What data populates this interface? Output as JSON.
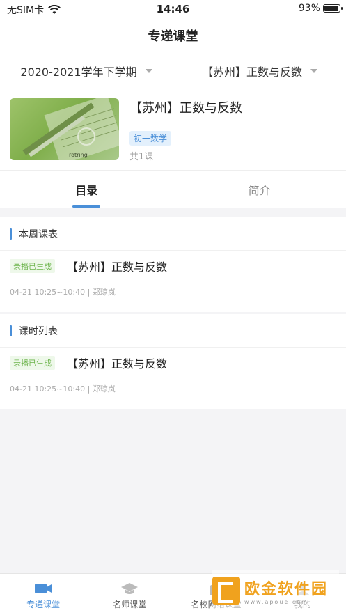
{
  "status_bar": {
    "carrier": "无SIM卡",
    "time": "14:46",
    "battery": "93%",
    "battery_level": 0.93
  },
  "header": {
    "title": "专递课堂"
  },
  "filters": {
    "term": "2020-2021学年下学期",
    "course": "【苏州】正数与反数"
  },
  "course": {
    "title": "【苏州】正数与反数",
    "tag": "初一数学",
    "count": "共1课",
    "thumb_label": "rotring"
  },
  "tabs": [
    {
      "label": "目录",
      "active": true
    },
    {
      "label": "简介",
      "active": false
    }
  ],
  "sections": [
    {
      "label": "本周课表",
      "lessons": [
        {
          "badge": "录播已生成",
          "title": "【苏州】正数与反数",
          "meta": "04-21 10:25~10:40 | 郑琼岚"
        }
      ]
    },
    {
      "label": "课时列表",
      "lessons": [
        {
          "badge": "录播已生成",
          "title": "【苏州】正数与反数",
          "meta": "04-21 10:25~10:40 | 郑琼岚"
        }
      ]
    }
  ],
  "tab_bar": [
    {
      "label": "专递课堂",
      "icon": "video-camera-icon",
      "active": true
    },
    {
      "label": "名师课堂",
      "icon": "graduation-cap-icon",
      "active": false
    },
    {
      "label": "名校网络课堂",
      "icon": "school-icon",
      "active": false
    },
    {
      "label": "我的",
      "icon": "user-icon",
      "active": false
    }
  ],
  "watermark": {
    "title": "欧金软件园",
    "url": "www.apoue.com"
  },
  "colors": {
    "accent": "#4a8fd8",
    "badge_green": "#6bb34a",
    "watermark": "#f0a21e"
  }
}
